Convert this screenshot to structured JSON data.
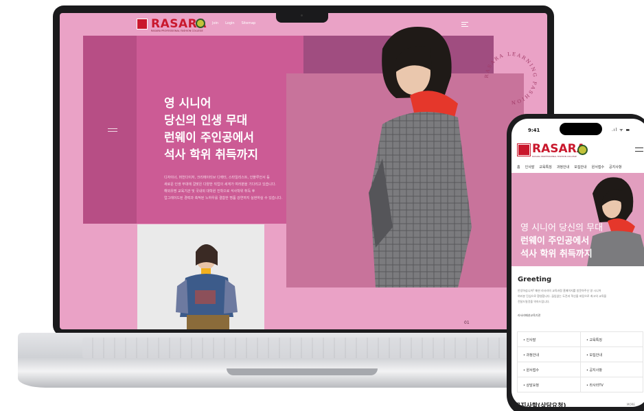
{
  "laptop": {
    "brand": "RASARA",
    "brand_subtitle": "RASARA PROFESSIONAL FASHION COLLEGE",
    "nav": [
      "Join",
      "Login",
      "Sitemap"
    ],
    "headline": [
      "영 시니어",
      "당신의 인생 무대",
      "런웨이 주인공에서",
      "석사 학위 취득까지"
    ],
    "paragraph": [
      "디자이너, 머천다이저, 크리에이티브 디렉터, 스타일리스트, 인플루언서 등",
      "새로운 인생 무대에 걸맞은 다양한 직업의 세계가 여러분을 기다리고 있습니다.",
      "해외유명 교육기관 및 국내외 대학원 진학으로 석사학위 취득 후",
      "업그레이드된 경력과 축적된 노하우를 결합한 명품 강연까지 실현하실 수 있습니다."
    ],
    "circular_text": "RASARA LEARNING FASHION",
    "slide_number": "01",
    "colors": {
      "accent": "#c9182d",
      "bg_pink": "#eaa2c6",
      "magenta": "#cc5b95"
    }
  },
  "phone": {
    "time": "9:41",
    "status_icons": ".ıl ᯤ ▬",
    "brand": "RASARA",
    "brand_subtitle": "RASARA PROFESSIONAL FASHION COLLEGE",
    "nav": [
      "홈",
      "인사말",
      "교육특징",
      "과정안내",
      "모집안내",
      "원서접수",
      "공지사항"
    ],
    "hero": {
      "line1": "영 시니어 당신의 무대",
      "line2": "런웨이 주인공에서",
      "line3": "석사 학위 취득까지"
    },
    "greeting_title": "Greeting",
    "greeting_body": [
      "안녕하십니까? 패션 라사라의 교육과정 홈페이지를 방문하주신 영 시니어",
      "여러분 진심으로 환영합니다. 끊임없는 도전과 혁신을 바탕으로 최고의 교육을",
      "전달드릴것을 약속드립니다."
    ],
    "signature": "라사라패션교육기관",
    "quick_links": [
      [
        "인사말",
        "교육특징"
      ],
      [
        "과정안내",
        "모집안내"
      ],
      [
        "원서접수",
        "공지사항"
      ],
      [
        "상담요청",
        "라사라TV"
      ]
    ],
    "notice_title": "공지사항(상담요청)",
    "notice_more": "MORE"
  }
}
